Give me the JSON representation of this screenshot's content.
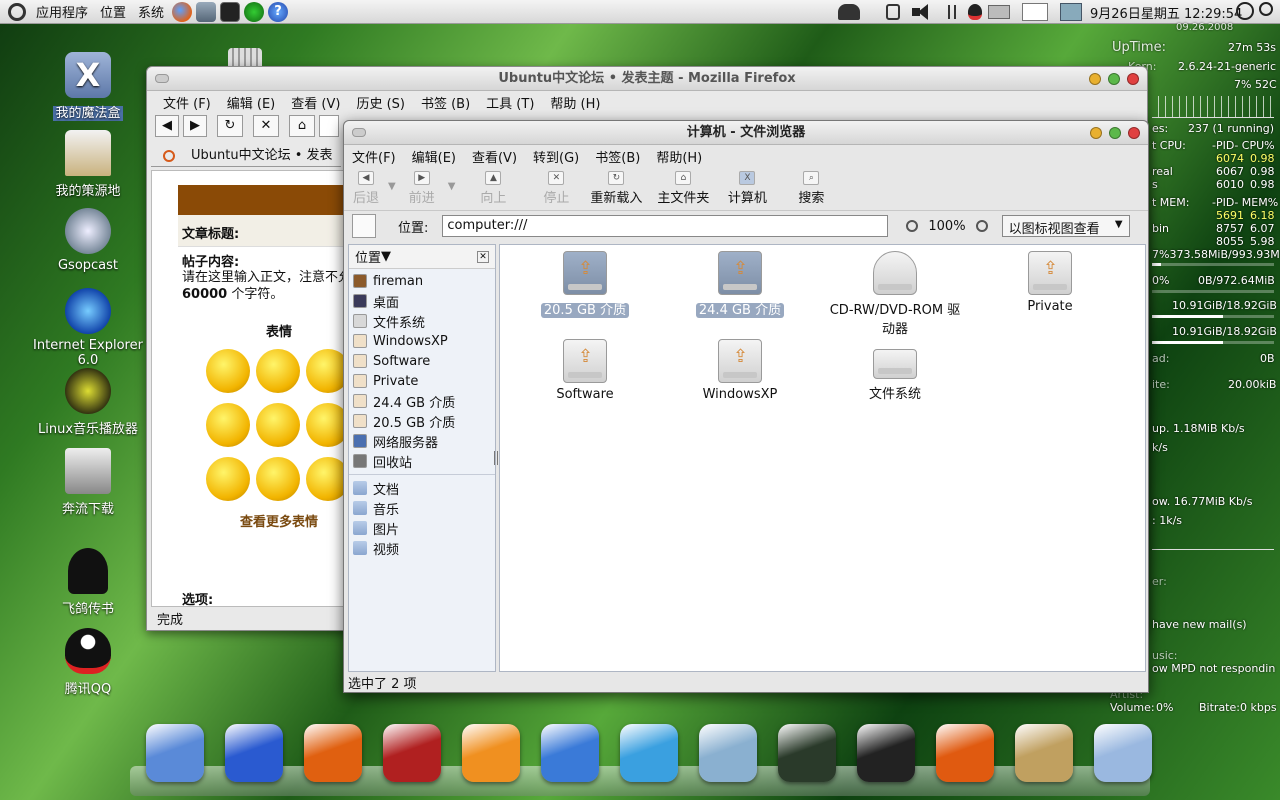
{
  "top_panel": {
    "menus": [
      "应用程序",
      "位置",
      "系统"
    ],
    "clock": "9月26日星期五 12:29:54"
  },
  "desktop_icons": [
    "我的魔法盒",
    "我的策源地",
    "Gsopcast",
    "Internet Explorer 6.0",
    "Linux音乐播放器",
    "奔流下载",
    "飞鸽传书",
    "腾讯QQ"
  ],
  "conky": {
    "clock_date": "09.26.2008",
    "uptime_label": "UpTime:",
    "uptime": "27m 53s",
    "kernel_label": "Kern:",
    "kernel": "2.6.24-21-generic",
    "cpu_usage": "7% 52C",
    "procs_label": "es:",
    "procs": "237  (1 running)",
    "top_cpu_label": "t CPU:",
    "top_cpu_header": "-PID-  CPU%",
    "top_cpu": [
      {
        "name": "",
        "pid": "6074",
        "val": "0.98"
      },
      {
        "name": "real",
        "pid": "6067",
        "val": "0.98"
      },
      {
        "name": "s",
        "pid": "6010",
        "val": "0.98"
      }
    ],
    "top_mem_label": "t MEM:",
    "top_mem_header": "-PID-  MEM%",
    "top_mem": [
      {
        "name": "",
        "pid": "5691",
        "val": "6.18"
      },
      {
        "name": "bin",
        "pid": "8757",
        "val": "6.07"
      },
      {
        "name": "",
        "pid": "8055",
        "val": "5.98"
      }
    ],
    "ram": "7%373.58MiB/993.93M",
    "swap_pct": "0%",
    "swap": "0B/972.64MiB",
    "fs1": "10.91GiB/18.92GiB",
    "fs2": "10.91GiB/18.92GiB",
    "read_label": "ad:",
    "read": "0B",
    "write_label": "ite:",
    "write": "20.00kiB",
    "up": "up. 1.18MiB Kb/s",
    "up_k": "k/s",
    "down": "ow. 16.77MiB Kb/s",
    "down_k": ": 1k/s",
    "mail_label": "er:",
    "mail": "have  new mail(s)",
    "music_label": "usic:",
    "music": "ow MPD not respondin",
    "artist_label": "Artist:",
    "volume_label": "Volume:",
    "volume": "0%",
    "bitrate_label": "Bitrate:",
    "bitrate": "0 kbps"
  },
  "firefox": {
    "title": "Ubuntu中文论坛 • 发表主题 - Mozilla Firefox",
    "menus": [
      "文件 (F)",
      "编辑 (E)",
      "查看 (V)",
      "历史 (S)",
      "书签 (B)",
      "工具 (T)",
      "帮助 (H)"
    ],
    "tab": "Ubuntu中文论坛 • 发表主",
    "subject_label": "文章标题:",
    "body_label": "帖子内容:",
    "hint": "请在这里输入正文，注意不允许",
    "limit": "60000",
    "limit_unit": " 个字符。",
    "emoticons_title": "表情",
    "more_emoticons": "查看更多表情",
    "options_label": "选项:",
    "status": "完成"
  },
  "nautilus": {
    "title": "计算机 - 文件浏览器",
    "menus": [
      "文件(F)",
      "编辑(E)",
      "查看(V)",
      "转到(G)",
      "书签(B)",
      "帮助(H)"
    ],
    "toolbar": {
      "back": "后退",
      "forward": "前进",
      "up": "向上",
      "stop": "停止",
      "reload": "重新载入",
      "home": "主文件夹",
      "computer": "计算机",
      "search": "搜索"
    },
    "location_label": "位置:",
    "location": "computer:///",
    "zoom": "100%",
    "view_mode": "以图标视图查看",
    "sidebar_title": "位置",
    "places": [
      "fireman",
      "桌面",
      "文件系统",
      "WindowsXP",
      "Software",
      "Private",
      "24.4 GB 介质",
      "20.5 GB 介质",
      "网络服务器",
      "回收站"
    ],
    "bookmarks": [
      "文档",
      "音乐",
      "图片",
      "视频"
    ],
    "items": [
      {
        "label": "20.5 GB 介质",
        "selected": true
      },
      {
        "label": "24.4 GB 介质",
        "selected": true
      },
      {
        "label": "CD-RW/DVD-ROM 驱动器",
        "selected": false
      },
      {
        "label": "Private",
        "selected": false
      },
      {
        "label": "Software",
        "selected": false
      },
      {
        "label": "WindowsXP",
        "selected": false
      },
      {
        "label": "文件系统",
        "selected": false
      }
    ],
    "status": "选中了 2 项"
  },
  "dock": [
    "finder-icon",
    "editor-icon",
    "presentation-icon",
    "dictionary-icon",
    "browser-icon",
    "video-chat-icon",
    "messenger-icon",
    "preview-icon",
    "system-monitor-icon",
    "terminal-icon",
    "firefox-icon",
    "image-viewer-icon",
    "folder-icon"
  ]
}
